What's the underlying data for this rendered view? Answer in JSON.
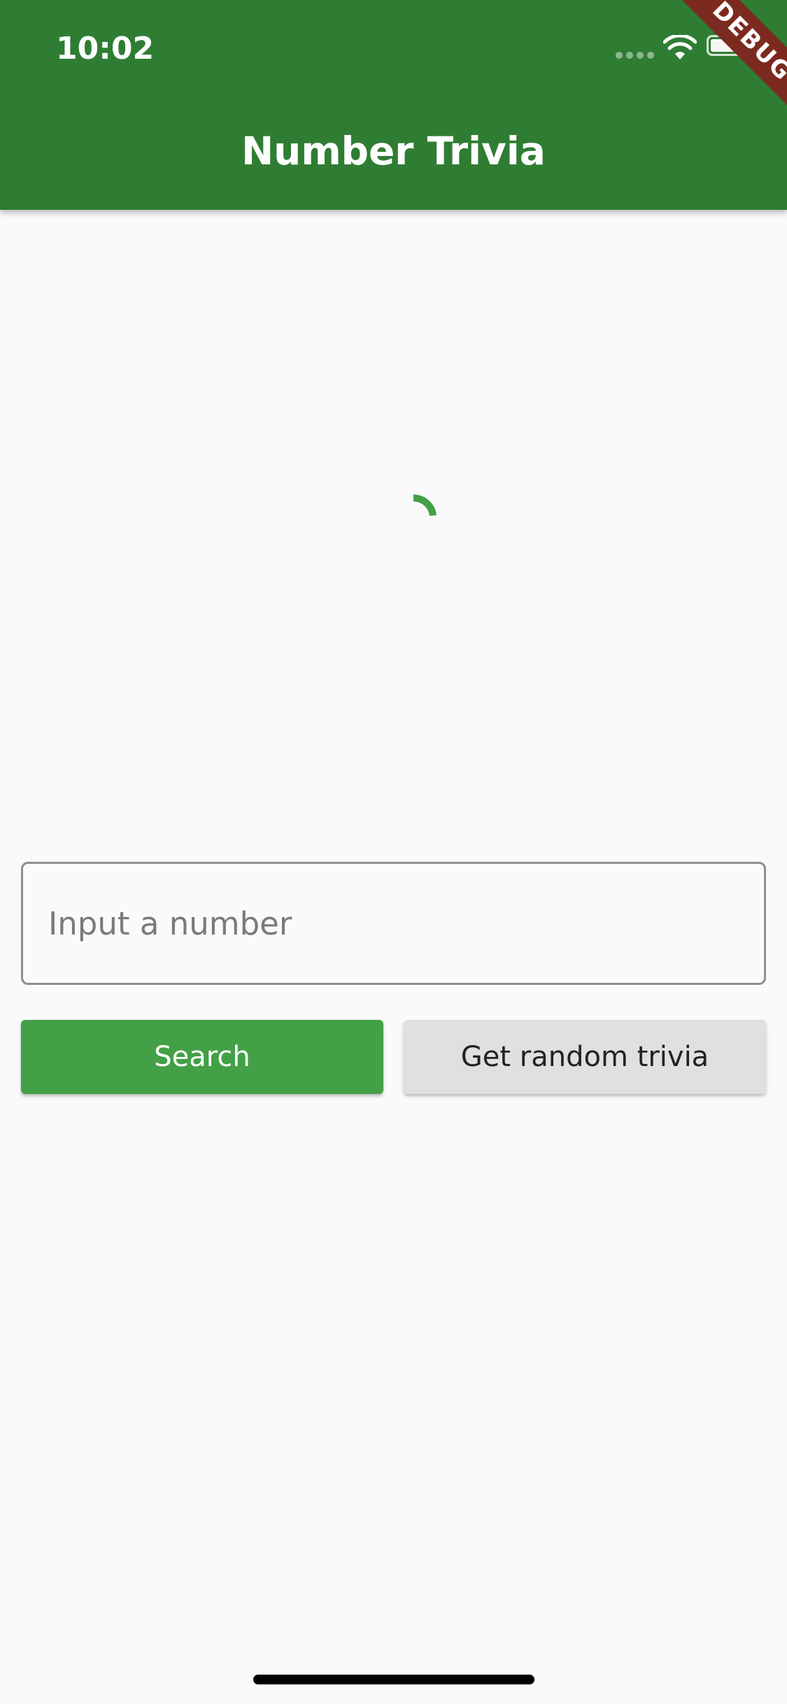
{
  "status_bar": {
    "time": "10:02"
  },
  "app_bar": {
    "title": "Number Trivia",
    "debug_banner": "DEBUG",
    "color": "#2f7d33"
  },
  "loading": {
    "indicator": "circular-progress-icon",
    "color": "#43a047"
  },
  "controls": {
    "input": {
      "placeholder": "Input a number",
      "value": ""
    },
    "search_label": "Search",
    "random_label": "Get random trivia"
  }
}
